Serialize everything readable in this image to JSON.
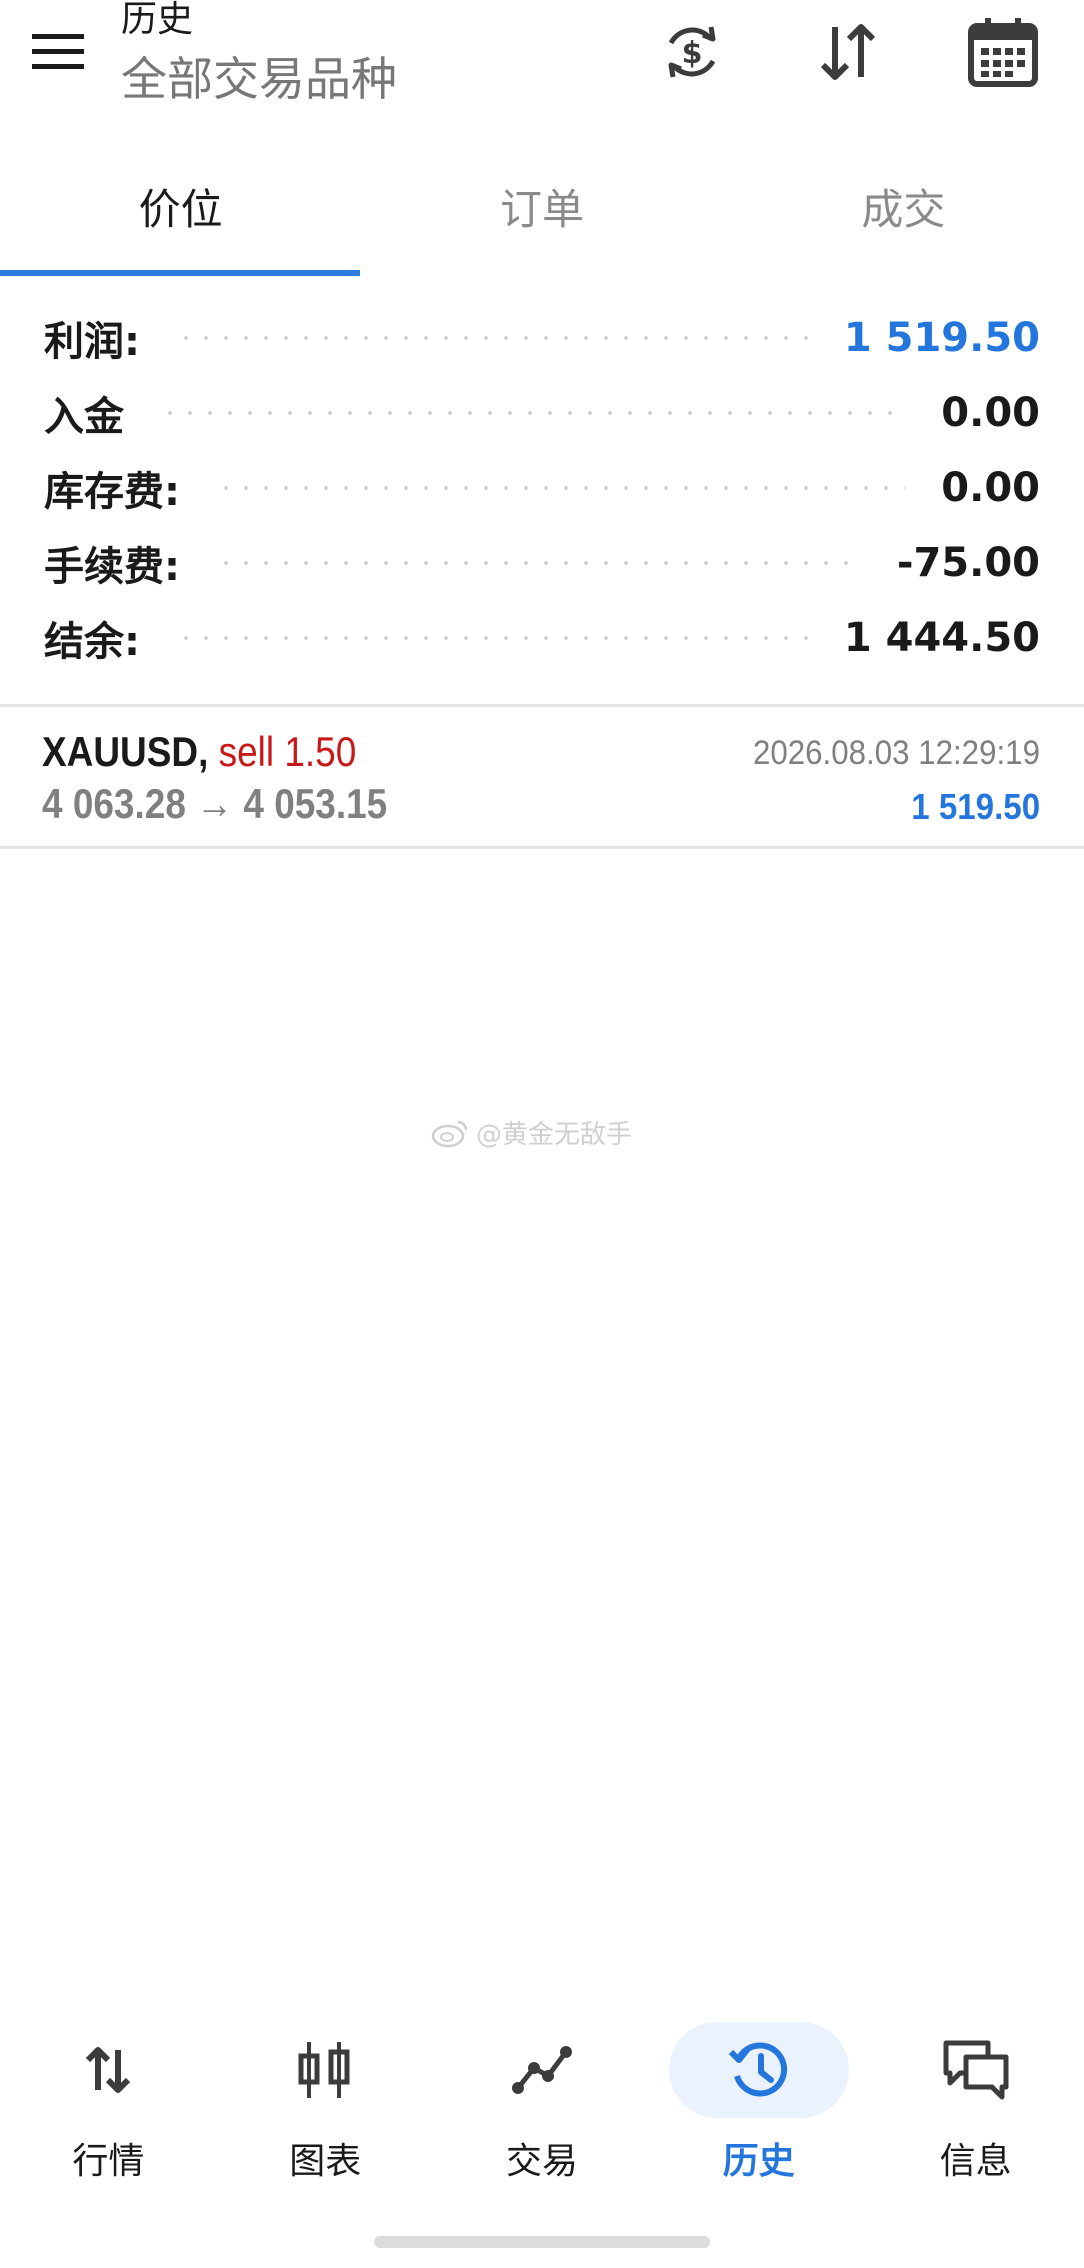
{
  "header": {
    "title": "历史",
    "subtitle": "全部交易品种",
    "icons": [
      "menu-icon",
      "currency-exchange-icon",
      "sort-icon",
      "calendar-icon"
    ]
  },
  "tabs": [
    {
      "label": "价位",
      "active": true
    },
    {
      "label": "订单",
      "active": false
    },
    {
      "label": "成交",
      "active": false
    }
  ],
  "summary": [
    {
      "label": "利润:",
      "value": "1 519.50"
    },
    {
      "label": "入金",
      "value": "0.00"
    },
    {
      "label": "库存费:",
      "value": "0.00"
    },
    {
      "label": "手续费:",
      "value": "-75.00"
    },
    {
      "label": "结余:",
      "value": "1 444.50"
    }
  ],
  "deals": [
    {
      "symbol": "XAUUSD,",
      "type": "sell 1.50",
      "prices": "4 063.28 → 4 053.15",
      "time": "2026.08.03 12:29:19",
      "profit": "1 519.50"
    }
  ],
  "watermark": "@黄金无敌手",
  "bottom_nav": [
    {
      "label": "行情",
      "icon": "quotes-icon",
      "active": false
    },
    {
      "label": "图表",
      "icon": "candlestick-chart-icon",
      "active": false
    },
    {
      "label": "交易",
      "icon": "trade-line-icon",
      "active": false
    },
    {
      "label": "历史",
      "icon": "history-clock-icon",
      "active": true
    },
    {
      "label": "信息",
      "icon": "messages-icon",
      "active": false
    }
  ],
  "colors": {
    "accent": "#2476dc",
    "sell": "#c81919",
    "muted": "#808080"
  }
}
